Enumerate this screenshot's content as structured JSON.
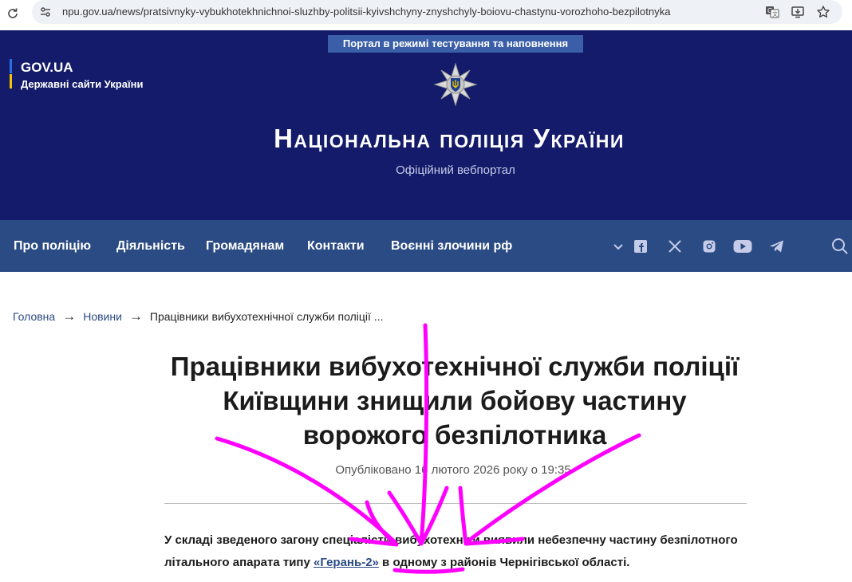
{
  "browser": {
    "url": "npu.gov.ua/news/pratsivnyky-vybukhotekhnichnoi-sluzhby-politsii-kyivshchyny-znyshchyly-boiovu-chastynu-vorozhoho-bezpilotnyka",
    "icons": [
      "reload-icon",
      "site-info-icon",
      "translate-icon",
      "install-icon",
      "bookmark-star-icon"
    ]
  },
  "header": {
    "test_banner": "Портал в режимі тестування та наповнення",
    "govua_title": "GOV.UA",
    "govua_subtitle": "Державні сайти України",
    "site_title": "Національна поліція України",
    "site_subtitle": "Офіційний вебпортал",
    "colors": {
      "header_bg": "#131b6a",
      "nav_bg": "#2b4b84",
      "banner_bg": "#3a5fa8"
    }
  },
  "nav": {
    "items": [
      {
        "label": "Про поліцію"
      },
      {
        "label": "Діяльність"
      },
      {
        "label": "Громадянам"
      },
      {
        "label": "Контакти"
      },
      {
        "label": "Воєнні злочини рф"
      }
    ],
    "icons": [
      "chevron-down-icon",
      "facebook-icon",
      "x-icon",
      "instagram-icon",
      "youtube-icon",
      "telegram-icon",
      "search-icon"
    ]
  },
  "breadcrumb": {
    "home": "Головна",
    "news": "Новини",
    "current": "Працівники вибухотехнічної служби поліції ...",
    "separator": "→"
  },
  "article": {
    "title": "Працівники вибухотехнічної служби поліції Київщини знищили бойову частину ворожого безпілотника",
    "published": "Опубліковано 16 лютого 2026 року о 19:35",
    "lead_before": "У складі зведеного загону спеціалісти-вибухотехніки виявили небезпечну частину безпілотного літального апарата типу ",
    "lead_highlight": "«Герань-2»",
    "lead_after": " в одному з районів Чернігівської області."
  },
  "annotation": {
    "color": "#ff00ff"
  }
}
